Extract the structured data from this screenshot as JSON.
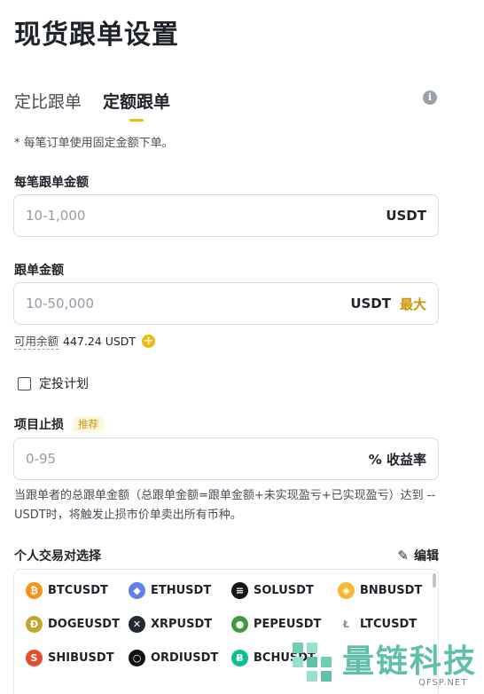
{
  "page": {
    "title": "现货跟单设置"
  },
  "tabs": [
    {
      "label": "定比跟单",
      "active": false
    },
    {
      "label": "定额跟单",
      "active": true
    }
  ],
  "info_icon": "info-icon",
  "note": "* 每笔订单使用固定金额下单。",
  "per_order": {
    "label": "每笔跟单金额",
    "placeholder": "10-1,000",
    "unit": "USDT"
  },
  "total": {
    "label": "跟单金额",
    "placeholder": "10-50,000",
    "unit": "USDT",
    "max_label": "最大"
  },
  "balance": {
    "label": "可用余额",
    "value": "447.24 USDT"
  },
  "dca": {
    "label": "定投计划",
    "checked": false
  },
  "stop_loss": {
    "label": "项目止损",
    "badge": "推荐",
    "placeholder": "0-95",
    "unit": "% 收益率",
    "description": "当跟单者的总跟单金额（总跟单金额=跟单金额+未实现盈亏+已实现盈亏）达到 -- USDT时，将触发止损市价单卖出所有币种。"
  },
  "pairs": {
    "label": "个人交易对选择",
    "edit_label": "编辑",
    "items": [
      {
        "symbol": "BTCUSDT",
        "icon": "btc-icon",
        "glyph": "₿",
        "color": "#f7931a"
      },
      {
        "symbol": "ETHUSDT",
        "icon": "eth-icon",
        "glyph": "◆",
        "color": "#627eea"
      },
      {
        "symbol": "SOLUSDT",
        "icon": "sol-icon",
        "glyph": "≡",
        "color": "#14161a"
      },
      {
        "symbol": "BNBUSDT",
        "icon": "bnb-icon",
        "glyph": "◈",
        "color": "#f3ba2f"
      },
      {
        "symbol": "DOGEUSDT",
        "icon": "doge-icon",
        "glyph": "Ð",
        "color": "#c2a633"
      },
      {
        "symbol": "XRPUSDT",
        "icon": "xrp-icon",
        "glyph": "✕",
        "color": "#23292f"
      },
      {
        "symbol": "PEPEUSDT",
        "icon": "pepe-icon",
        "glyph": "●",
        "color": "#3c9b3a"
      },
      {
        "symbol": "LTCUSDT",
        "icon": "ltc-icon",
        "glyph": "Ł",
        "color": "#ffffff"
      },
      {
        "symbol": "SHIBUSDT",
        "icon": "shib-icon",
        "glyph": "S",
        "color": "#e44c2c"
      },
      {
        "symbol": "ORDIUSDT",
        "icon": "ordi-icon",
        "glyph": "○",
        "color": "#111111"
      },
      {
        "symbol": "BCHUSDT",
        "icon": "bch-icon",
        "glyph": "Ƀ",
        "color": "#0ac18e"
      }
    ]
  },
  "watermark": {
    "text": "量链科技",
    "sub": "QFSP.NET"
  },
  "colors": {
    "accent": "#f0b90b",
    "accent_text": "#c99400",
    "text": "#1e2329",
    "muted": "#474d57"
  }
}
